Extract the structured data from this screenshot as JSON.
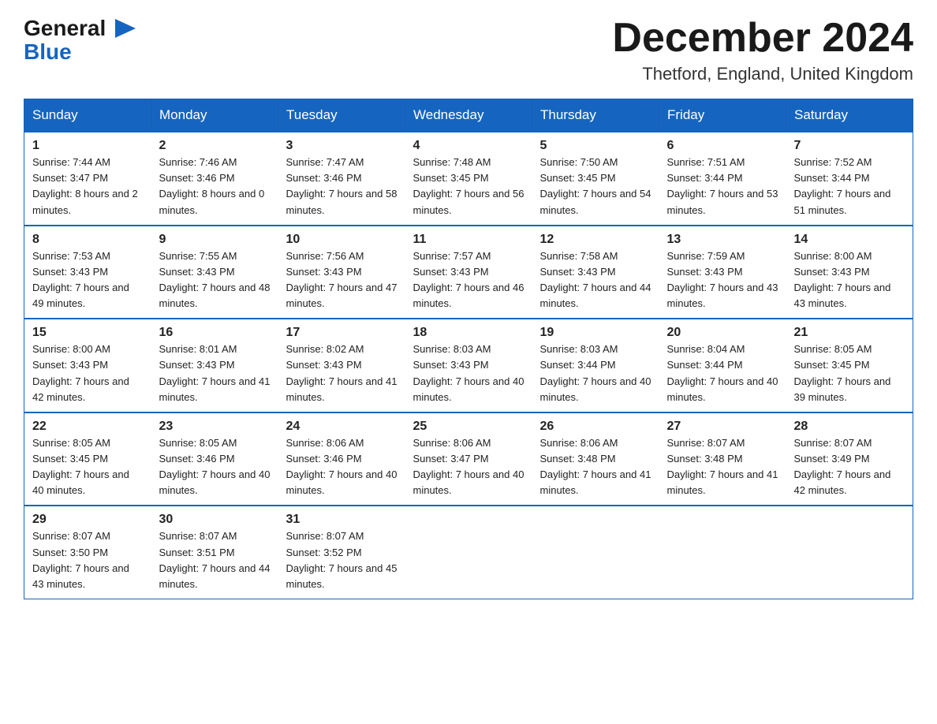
{
  "header": {
    "logo_general": "General",
    "logo_blue": "Blue",
    "month_title": "December 2024",
    "location": "Thetford, England, United Kingdom"
  },
  "weekdays": [
    "Sunday",
    "Monday",
    "Tuesday",
    "Wednesday",
    "Thursday",
    "Friday",
    "Saturday"
  ],
  "weeks": [
    [
      {
        "day": "1",
        "sunrise": "Sunrise: 7:44 AM",
        "sunset": "Sunset: 3:47 PM",
        "daylight": "Daylight: 8 hours and 2 minutes."
      },
      {
        "day": "2",
        "sunrise": "Sunrise: 7:46 AM",
        "sunset": "Sunset: 3:46 PM",
        "daylight": "Daylight: 8 hours and 0 minutes."
      },
      {
        "day": "3",
        "sunrise": "Sunrise: 7:47 AM",
        "sunset": "Sunset: 3:46 PM",
        "daylight": "Daylight: 7 hours and 58 minutes."
      },
      {
        "day": "4",
        "sunrise": "Sunrise: 7:48 AM",
        "sunset": "Sunset: 3:45 PM",
        "daylight": "Daylight: 7 hours and 56 minutes."
      },
      {
        "day": "5",
        "sunrise": "Sunrise: 7:50 AM",
        "sunset": "Sunset: 3:45 PM",
        "daylight": "Daylight: 7 hours and 54 minutes."
      },
      {
        "day": "6",
        "sunrise": "Sunrise: 7:51 AM",
        "sunset": "Sunset: 3:44 PM",
        "daylight": "Daylight: 7 hours and 53 minutes."
      },
      {
        "day": "7",
        "sunrise": "Sunrise: 7:52 AM",
        "sunset": "Sunset: 3:44 PM",
        "daylight": "Daylight: 7 hours and 51 minutes."
      }
    ],
    [
      {
        "day": "8",
        "sunrise": "Sunrise: 7:53 AM",
        "sunset": "Sunset: 3:43 PM",
        "daylight": "Daylight: 7 hours and 49 minutes."
      },
      {
        "day": "9",
        "sunrise": "Sunrise: 7:55 AM",
        "sunset": "Sunset: 3:43 PM",
        "daylight": "Daylight: 7 hours and 48 minutes."
      },
      {
        "day": "10",
        "sunrise": "Sunrise: 7:56 AM",
        "sunset": "Sunset: 3:43 PM",
        "daylight": "Daylight: 7 hours and 47 minutes."
      },
      {
        "day": "11",
        "sunrise": "Sunrise: 7:57 AM",
        "sunset": "Sunset: 3:43 PM",
        "daylight": "Daylight: 7 hours and 46 minutes."
      },
      {
        "day": "12",
        "sunrise": "Sunrise: 7:58 AM",
        "sunset": "Sunset: 3:43 PM",
        "daylight": "Daylight: 7 hours and 44 minutes."
      },
      {
        "day": "13",
        "sunrise": "Sunrise: 7:59 AM",
        "sunset": "Sunset: 3:43 PM",
        "daylight": "Daylight: 7 hours and 43 minutes."
      },
      {
        "day": "14",
        "sunrise": "Sunrise: 8:00 AM",
        "sunset": "Sunset: 3:43 PM",
        "daylight": "Daylight: 7 hours and 43 minutes."
      }
    ],
    [
      {
        "day": "15",
        "sunrise": "Sunrise: 8:00 AM",
        "sunset": "Sunset: 3:43 PM",
        "daylight": "Daylight: 7 hours and 42 minutes."
      },
      {
        "day": "16",
        "sunrise": "Sunrise: 8:01 AM",
        "sunset": "Sunset: 3:43 PM",
        "daylight": "Daylight: 7 hours and 41 minutes."
      },
      {
        "day": "17",
        "sunrise": "Sunrise: 8:02 AM",
        "sunset": "Sunset: 3:43 PM",
        "daylight": "Daylight: 7 hours and 41 minutes."
      },
      {
        "day": "18",
        "sunrise": "Sunrise: 8:03 AM",
        "sunset": "Sunset: 3:43 PM",
        "daylight": "Daylight: 7 hours and 40 minutes."
      },
      {
        "day": "19",
        "sunrise": "Sunrise: 8:03 AM",
        "sunset": "Sunset: 3:44 PM",
        "daylight": "Daylight: 7 hours and 40 minutes."
      },
      {
        "day": "20",
        "sunrise": "Sunrise: 8:04 AM",
        "sunset": "Sunset: 3:44 PM",
        "daylight": "Daylight: 7 hours and 40 minutes."
      },
      {
        "day": "21",
        "sunrise": "Sunrise: 8:05 AM",
        "sunset": "Sunset: 3:45 PM",
        "daylight": "Daylight: 7 hours and 39 minutes."
      }
    ],
    [
      {
        "day": "22",
        "sunrise": "Sunrise: 8:05 AM",
        "sunset": "Sunset: 3:45 PM",
        "daylight": "Daylight: 7 hours and 40 minutes."
      },
      {
        "day": "23",
        "sunrise": "Sunrise: 8:05 AM",
        "sunset": "Sunset: 3:46 PM",
        "daylight": "Daylight: 7 hours and 40 minutes."
      },
      {
        "day": "24",
        "sunrise": "Sunrise: 8:06 AM",
        "sunset": "Sunset: 3:46 PM",
        "daylight": "Daylight: 7 hours and 40 minutes."
      },
      {
        "day": "25",
        "sunrise": "Sunrise: 8:06 AM",
        "sunset": "Sunset: 3:47 PM",
        "daylight": "Daylight: 7 hours and 40 minutes."
      },
      {
        "day": "26",
        "sunrise": "Sunrise: 8:06 AM",
        "sunset": "Sunset: 3:48 PM",
        "daylight": "Daylight: 7 hours and 41 minutes."
      },
      {
        "day": "27",
        "sunrise": "Sunrise: 8:07 AM",
        "sunset": "Sunset: 3:48 PM",
        "daylight": "Daylight: 7 hours and 41 minutes."
      },
      {
        "day": "28",
        "sunrise": "Sunrise: 8:07 AM",
        "sunset": "Sunset: 3:49 PM",
        "daylight": "Daylight: 7 hours and 42 minutes."
      }
    ],
    [
      {
        "day": "29",
        "sunrise": "Sunrise: 8:07 AM",
        "sunset": "Sunset: 3:50 PM",
        "daylight": "Daylight: 7 hours and 43 minutes."
      },
      {
        "day": "30",
        "sunrise": "Sunrise: 8:07 AM",
        "sunset": "Sunset: 3:51 PM",
        "daylight": "Daylight: 7 hours and 44 minutes."
      },
      {
        "day": "31",
        "sunrise": "Sunrise: 8:07 AM",
        "sunset": "Sunset: 3:52 PM",
        "daylight": "Daylight: 7 hours and 45 minutes."
      },
      null,
      null,
      null,
      null
    ]
  ]
}
